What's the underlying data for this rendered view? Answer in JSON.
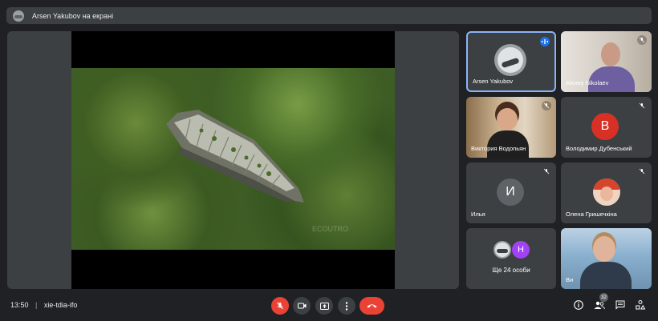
{
  "presentation_bar": {
    "text": "Arsen Yakubov на екрані",
    "icon": "presenter-avatar"
  },
  "stage": {
    "watermark": "ECOUTRO"
  },
  "participants": [
    {
      "name": "Arsen Yakubov",
      "status": "speaking",
      "icon": "sound-wave-icon"
    },
    {
      "name": "Alexey Nikolaev",
      "status": "muted"
    },
    {
      "name": "Виктория Водопьян",
      "status": "muted"
    },
    {
      "name": "Володимир Дубенський",
      "status": "muted",
      "initial": "В",
      "color": "#d93025"
    },
    {
      "name": "Илья",
      "status": "muted",
      "initial": "И",
      "color": "#5f6368"
    },
    {
      "name": "Олена Гришечкіна",
      "status": "muted"
    }
  ],
  "others": {
    "label": "Ще 24 особи",
    "initial": "Н",
    "color": "#a142f4"
  },
  "last_tile": {
    "name": "Ви"
  },
  "bottom": {
    "time": "13:50",
    "separator": "|",
    "meeting_code": "xie-tdia-ifo",
    "participants_count": "32"
  },
  "colors": {
    "end_call": "#ea4335",
    "mic_off": "#ea4335",
    "speaking": "#1a73e8"
  }
}
